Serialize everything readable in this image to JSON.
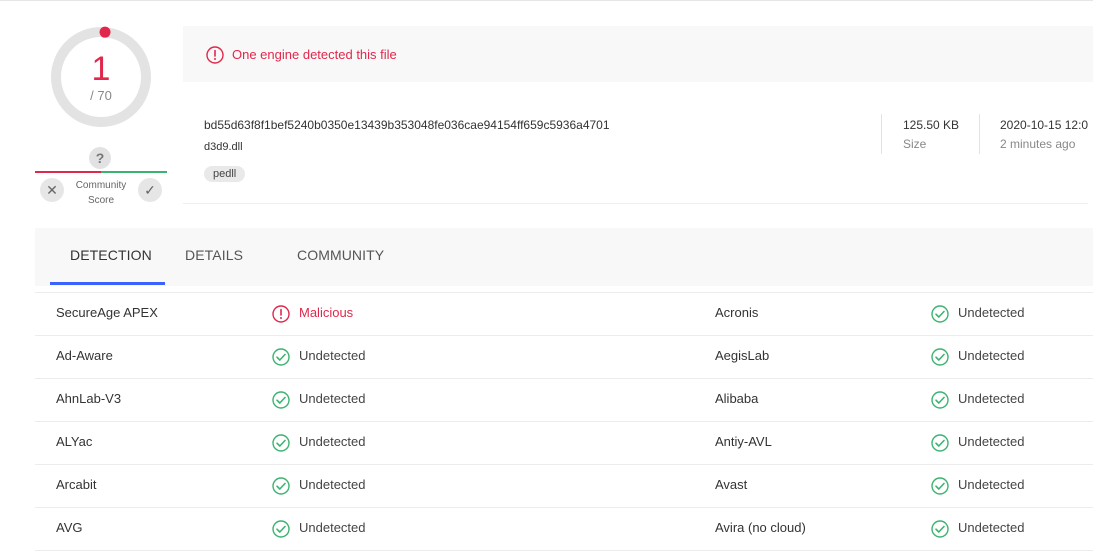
{
  "summary": {
    "detections": "1",
    "total": "/ 70",
    "community_label_1": "Community",
    "community_label_2": "Score",
    "question_mark": "?",
    "vote_down_glyph": "✕",
    "vote_up_glyph": "✓",
    "gauge_fraction": 0.0143
  },
  "banner": {
    "text": "One engine detected this file",
    "color": "#e0284c"
  },
  "file": {
    "sha256": "bd55d63f8f1bef5240b0350e13439b353048fe036cae94154ff659c5936a4701",
    "name": "d3d9.dll",
    "tag": "pedll",
    "size_value": "125.50 KB",
    "size_label": "Size",
    "date_value": "2020-10-15 12:0",
    "date_label": "2 minutes ago"
  },
  "tabs": [
    {
      "label": "DETECTION",
      "active": true
    },
    {
      "label": "DETAILS",
      "active": false
    },
    {
      "label": "COMMUNITY",
      "active": false
    }
  ],
  "detections": [
    {
      "left_engine": "SecureAge APEX",
      "left_result": "Malicious",
      "left_status": "malicious",
      "right_engine": "Acronis",
      "right_result": "Undetected",
      "right_status": "undetected"
    },
    {
      "left_engine": "Ad-Aware",
      "left_result": "Undetected",
      "left_status": "undetected",
      "right_engine": "AegisLab",
      "right_result": "Undetected",
      "right_status": "undetected"
    },
    {
      "left_engine": "AhnLab-V3",
      "left_result": "Undetected",
      "left_status": "undetected",
      "right_engine": "Alibaba",
      "right_result": "Undetected",
      "right_status": "undetected"
    },
    {
      "left_engine": "ALYac",
      "left_result": "Undetected",
      "left_status": "undetected",
      "right_engine": "Antiy-AVL",
      "right_result": "Undetected",
      "right_status": "undetected"
    },
    {
      "left_engine": "Arcabit",
      "left_result": "Undetected",
      "left_status": "undetected",
      "right_engine": "Avast",
      "right_result": "Undetected",
      "right_status": "undetected"
    },
    {
      "left_engine": "AVG",
      "left_result": "Undetected",
      "left_status": "undetected",
      "right_engine": "Avira (no cloud)",
      "right_result": "Undetected",
      "right_status": "undetected"
    }
  ],
  "colors": {
    "malicious": "#e0284c",
    "undetected": "#3cb371",
    "accent": "#3b61ff"
  },
  "icons": {
    "malicious": "alert-circle-icon",
    "undetected": "check-circle-icon"
  }
}
